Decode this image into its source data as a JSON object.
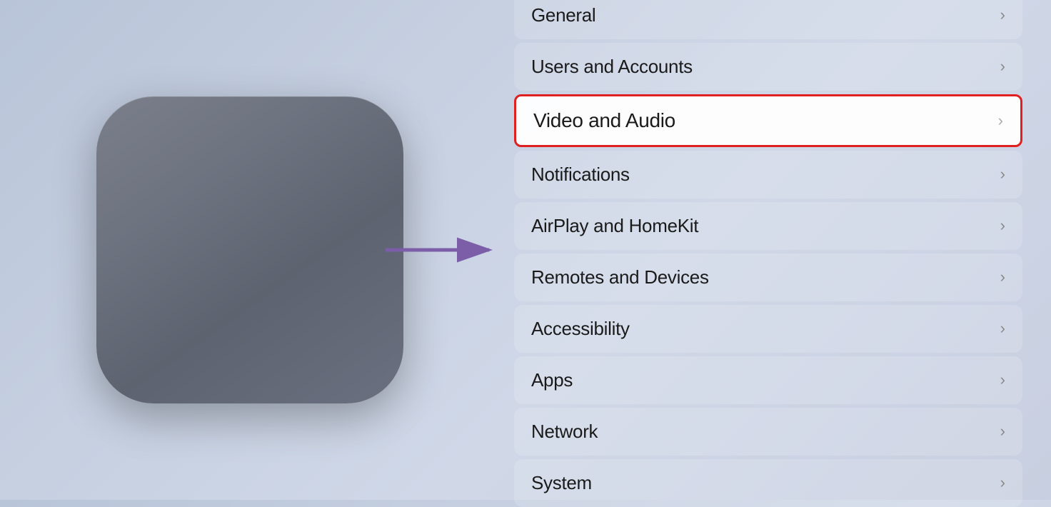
{
  "device": {
    "logo": "",
    "alt": "Apple TV"
  },
  "arrow": {
    "color": "#7B5EA7"
  },
  "menu": {
    "items": [
      {
        "id": "general",
        "label": "General",
        "highlighted": false
      },
      {
        "id": "users-and-accounts",
        "label": "Users and Accounts",
        "highlighted": false
      },
      {
        "id": "video-and-audio",
        "label": "Video and Audio",
        "highlighted": true
      },
      {
        "id": "notifications",
        "label": "Notifications",
        "highlighted": false
      },
      {
        "id": "airplay-and-homekit",
        "label": "AirPlay and HomeKit",
        "highlighted": false
      },
      {
        "id": "remotes-and-devices",
        "label": "Remotes and Devices",
        "highlighted": false
      },
      {
        "id": "accessibility",
        "label": "Accessibility",
        "highlighted": false
      },
      {
        "id": "apps",
        "label": "Apps",
        "highlighted": false
      },
      {
        "id": "network",
        "label": "Network",
        "highlighted": false
      },
      {
        "id": "system",
        "label": "System",
        "highlighted": false
      }
    ],
    "chevron": "›"
  }
}
